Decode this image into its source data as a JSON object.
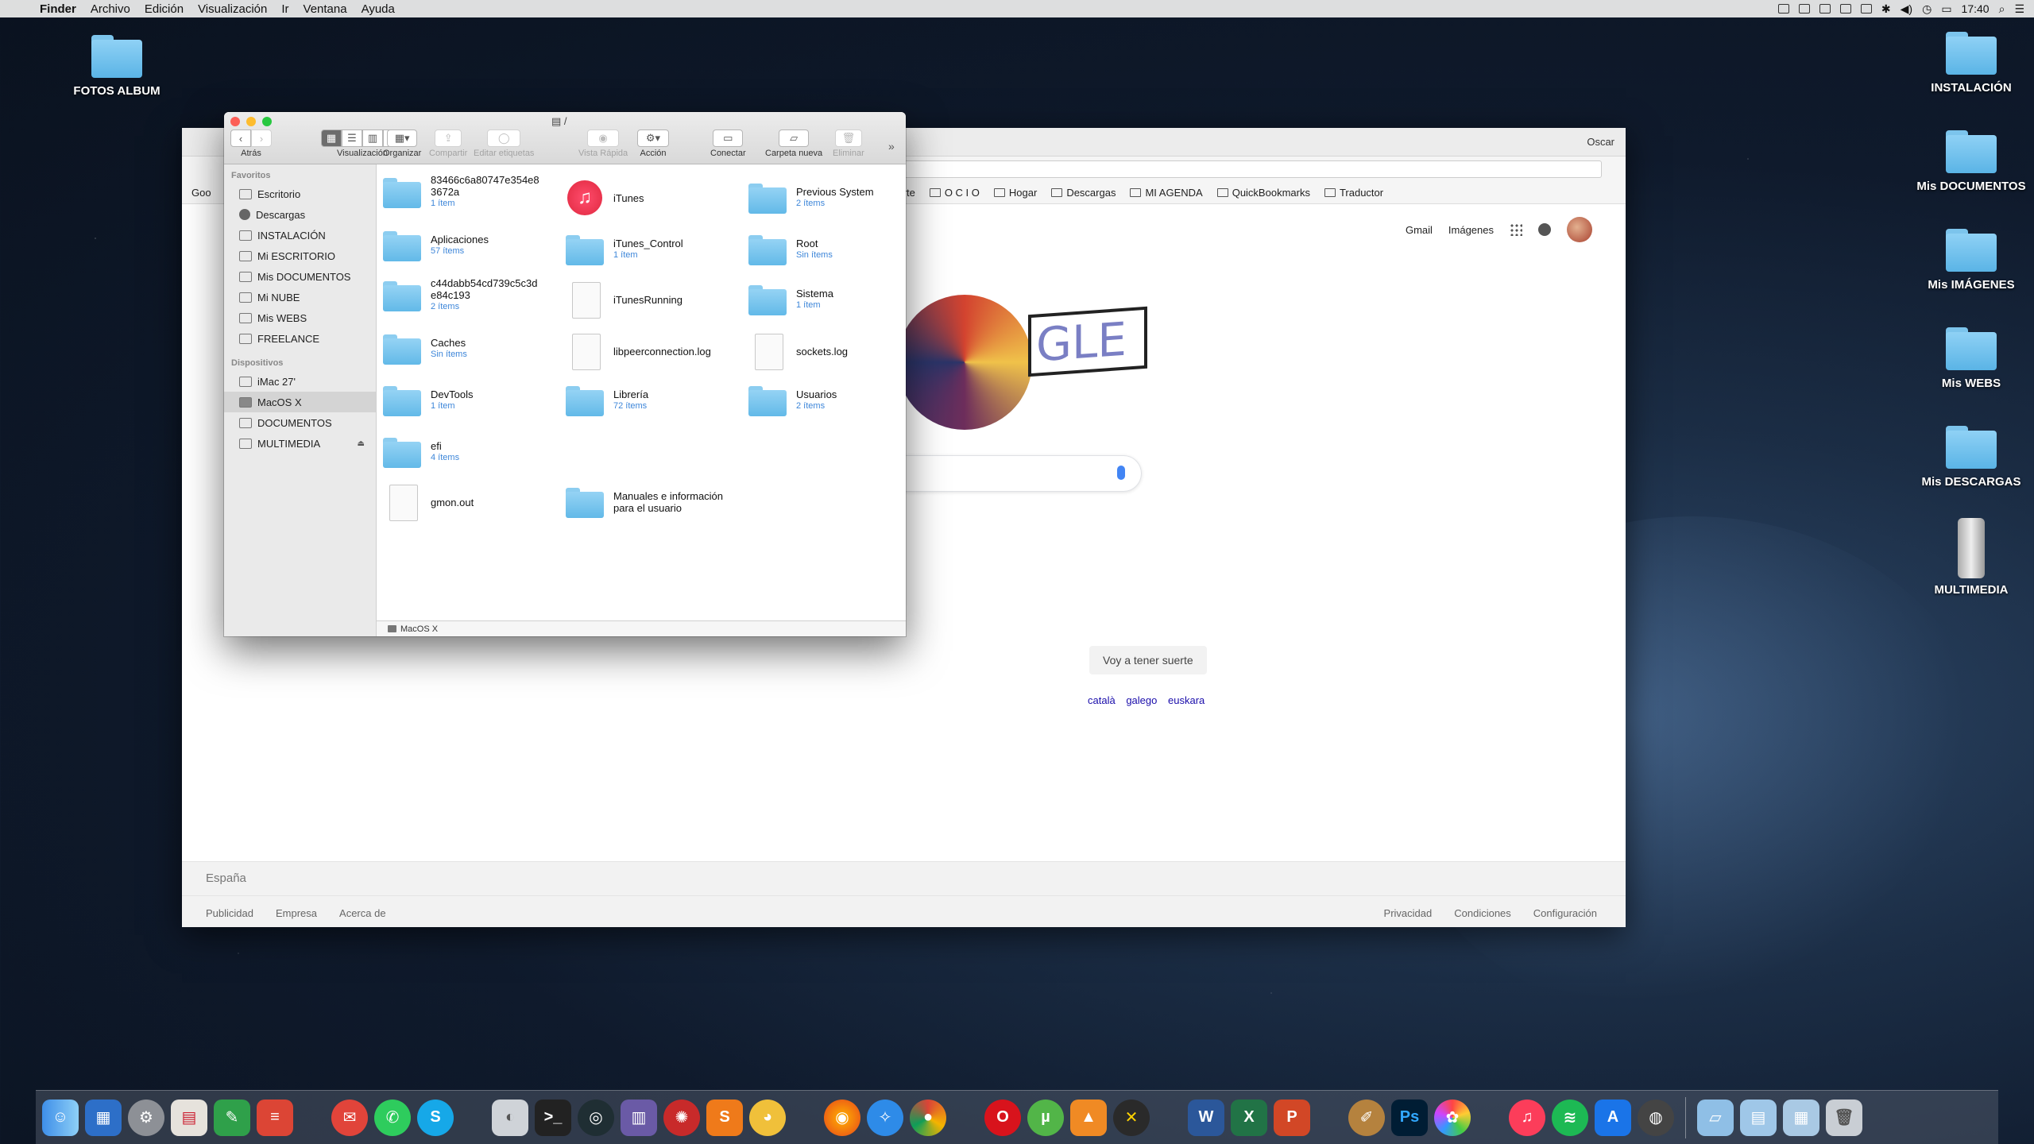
{
  "menubar": {
    "app_name": "Finder",
    "menus": [
      "Archivo",
      "Edición",
      "Visualización",
      "Ir",
      "Ventana",
      "Ayuda"
    ],
    "clock": "17:40"
  },
  "desktop": {
    "left_icons": [
      {
        "label": "FOTOS ALBUM"
      }
    ],
    "right_icons": [
      {
        "label": "INSTALACIÓN"
      },
      {
        "label": "Mis DOCUMENTOS"
      },
      {
        "label": "Mis IMÁGENES"
      },
      {
        "label": "Mis WEBS"
      },
      {
        "label": "Mis DESCARGAS"
      },
      {
        "label": "MULTIMEDIA"
      }
    ]
  },
  "browser": {
    "user": "Oscar",
    "bookmarks": [
      "Deporte",
      "O C I O",
      "Hogar",
      "Descargas",
      "MI AGENDA",
      "QuickBookmarks",
      "Traductor"
    ],
    "bookmark_partial": "Goo",
    "top_links": [
      "Gmail",
      "Imágenes"
    ],
    "doodle_text": "GLE",
    "lucky_button": "Voy a tener suerte",
    "languages": [
      "català",
      "galego",
      "euskara"
    ],
    "footer": {
      "country": "España",
      "left_links": [
        "Publicidad",
        "Empresa",
        "Acerca de"
      ],
      "right_links": [
        "Privacidad",
        "Condiciones",
        "Configuración"
      ]
    }
  },
  "finder": {
    "title": "/",
    "toolbar": {
      "back_label": "Atrás",
      "view_label": "Visualización",
      "arrange_label": "Organizar",
      "share_label": "Compartir",
      "tags_label": "Editar etiquetas",
      "quicklook_label": "Vista Rápida",
      "action_label": "Acción",
      "connect_label": "Conectar",
      "newfolder_label": "Carpeta nueva",
      "delete_label": "Eliminar"
    },
    "sidebar": {
      "favorites_header": "Favoritos",
      "favorites": [
        "Escritorio",
        "Descargas",
        "INSTALACIÓN",
        "Mi ESCRITORIO",
        "Mis DOCUMENTOS",
        "Mi NUBE",
        "Mis WEBS",
        "FREELANCE"
      ],
      "devices_header": "Dispositivos",
      "devices": [
        "iMac 27'",
        "MacOS X",
        "DOCUMENTOS",
        "MULTIMEDIA"
      ]
    },
    "items": [
      {
        "name": "83466c6a80747e354e8",
        "name2": "3672a",
        "sub": "1 ítem",
        "kind": "folder"
      },
      {
        "name": "Aplicaciones",
        "sub": "57 ítems",
        "kind": "folder"
      },
      {
        "name": "c44dabb54cd739c5c3d",
        "name2": "e84c193",
        "sub": "2 ítems",
        "kind": "folder"
      },
      {
        "name": "Caches",
        "sub": "Sin ítems",
        "kind": "folder"
      },
      {
        "name": "DevTools",
        "sub": "1 ítem",
        "kind": "folder"
      },
      {
        "name": "efi",
        "sub": "4 ítems",
        "kind": "folder"
      },
      {
        "name": "gmon.out",
        "sub": "",
        "kind": "doc"
      },
      {
        "name": "iTunes",
        "sub": "",
        "kind": "itunes"
      },
      {
        "name": "iTunes_Control",
        "sub": "1 ítem",
        "kind": "folder"
      },
      {
        "name": "iTunesRunning",
        "sub": "",
        "kind": "doc"
      },
      {
        "name": "libpeerconnection.log",
        "sub": "",
        "kind": "doc"
      },
      {
        "name": "Librería",
        "sub": "72 ítems",
        "kind": "folder"
      },
      {
        "name": "Manuales e información",
        "name2": "para el usuario",
        "sub": "",
        "kind": "folder"
      },
      {
        "name": "Previous System",
        "sub": "2 ítems",
        "kind": "folder"
      },
      {
        "name": "Root",
        "sub": "Sin ítems",
        "kind": "folder"
      },
      {
        "name": "Sistema",
        "sub": "1 ítem",
        "kind": "folder"
      },
      {
        "name": "sockets.log",
        "sub": "",
        "kind": "doc"
      },
      {
        "name": "Usuarios",
        "sub": "2 ítems",
        "kind": "folder"
      }
    ],
    "path_bar": "MacOS X"
  }
}
